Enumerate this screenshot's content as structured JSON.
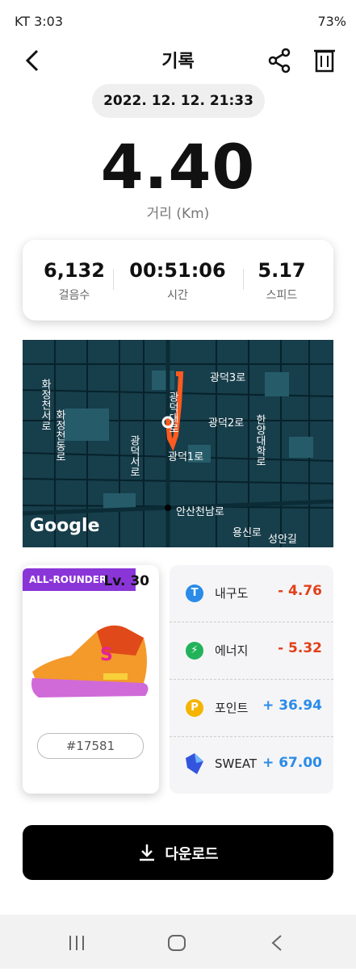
{
  "status_bar": {
    "left": "KT 3:03",
    "right": "73%"
  },
  "header": {
    "title": "기록"
  },
  "record": {
    "datetime": "2022. 12. 12. 21:33",
    "distance": "4.40",
    "distance_label": "거리 (Km)"
  },
  "stats": [
    {
      "value": "6,132",
      "label": "걸음수"
    },
    {
      "value": "00:51:06",
      "label": "시간"
    },
    {
      "value": "5.17",
      "label": "스피드"
    }
  ],
  "map": {
    "labels": [
      "광덕3로",
      "광덕2로",
      "광덕1로",
      "광덕대로",
      "광덕서로",
      "한양대학로",
      "화정천서로",
      "화정천동로",
      "안산천남로",
      "용신로",
      "성안길"
    ],
    "attribution": "Google",
    "route_color": "#ff5a1f"
  },
  "sneaker": {
    "type": "ALL-ROUNDER",
    "level": "Lv. 30",
    "id": "#17581"
  },
  "attributes": [
    {
      "name": "내구도",
      "value": "- 4.76",
      "icon": "T",
      "icon_color": "#2a8be8",
      "value_color": "#e2401a"
    },
    {
      "name": "에너지",
      "value": "- 5.32",
      "icon": "⚡",
      "icon_color": "#22b35a",
      "value_color": "#e2401a"
    },
    {
      "name": "포인트",
      "value": "+ 36.94",
      "icon": "P",
      "icon_color": "#f5b400",
      "value_color": "#2a8be8"
    },
    {
      "name": "SWEAT",
      "value": "+ 67.00",
      "icon": "sweat-crystal",
      "icon_color": "#3355dd",
      "value_color": "#2a8be8"
    }
  ],
  "download": {
    "label": "다운로드"
  }
}
